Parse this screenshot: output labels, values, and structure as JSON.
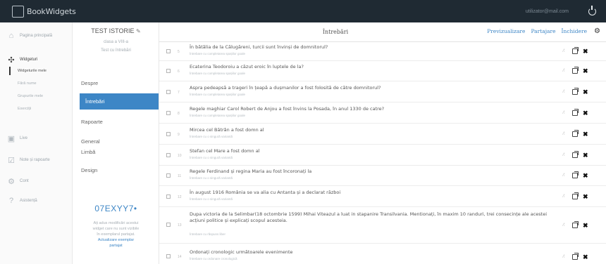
{
  "app": {
    "name": "BookWidgets",
    "user_email": "utilizator@mail.com"
  },
  "sidebar": {
    "home": "Pagina principală",
    "widgets": "Widgeturi",
    "sub_items": [
      "Widgeturile mele",
      "Fără nume",
      "Grupurile mele",
      "Exerciții"
    ],
    "live": "Live",
    "grading": "Note și rapoarte",
    "account": "Cont",
    "help": "Asistență"
  },
  "panel": {
    "title": "TEST ISTORIE",
    "class_label": "clasa a VIII-a",
    "subtitle": "Test cu întrebări",
    "menu": [
      "Despre",
      "Întrebări",
      "Rapoarte",
      "General",
      "Limbă",
      "Design"
    ],
    "active_index": 1,
    "code": "07EXYY7",
    "note_lines": [
      "Ați adus modificări acestui",
      "widget care nu sunt vizibile",
      "în exemplarul partajat."
    ],
    "note_link_lines": [
      "Actualizare exemplar",
      "partajat"
    ]
  },
  "header": {
    "title": "Întrebări",
    "preview": "Previzualizare",
    "share": "Partajare",
    "close": "Închidere"
  },
  "questions": [
    {
      "num": "5",
      "text": "În bătălia de la Călugăreni, turcii sunt învinși de domnitorul?",
      "sub": "Întrebare cu completarea spațiilor goale"
    },
    {
      "num": "6",
      "text": "Ecaterina Teodoroiu a căzut eroic în luptele de la?",
      "sub": "Întrebare cu completarea spațiilor goale"
    },
    {
      "num": "7",
      "text": "Aspra pedeapsă a trageri în țeapă a dușmanilor a fost folosită de către domnitorul?",
      "sub": "Întrebare cu completarea spațiilor goale"
    },
    {
      "num": "8",
      "text": "Regele maghiar Carol Robert de Anjou a fost învins la Posada, în anul 1330 de catre?",
      "sub": "Întrebare cu completarea spațiilor goale"
    },
    {
      "num": "9",
      "text": "Mircea cel Bătrân a fost domn al",
      "sub": "Întrebare cu o singură variantă"
    },
    {
      "num": "10",
      "text": "Stefan cel Mare a fost domn al",
      "sub": "Întrebare cu o singură variantă"
    },
    {
      "num": "11",
      "text": "Regele Ferdinand și regina Maria au fost încoronați la",
      "sub": "Întrebare cu o singură variantă"
    },
    {
      "num": "12",
      "text": "În august 1916 România se va alia cu Antanta și a declarat război",
      "sub": "Întrebare cu o singură variantă"
    },
    {
      "num": "13",
      "text": "Dupa victoria de la Selimbar(18 octombrie 1599) Mihai Viteazul a luat in stapanire Transilvania. Mentionați, în maxim 10 randuri, trei consecințe ale acestei acțiuni politice și explicați scopul acesteia.",
      "sub": "Întrebare cu răspuns liber"
    },
    {
      "num": "14",
      "text": "Ordonați cronologic următoarele evenimente",
      "sub": "Întrebare cu ordonare cronologică"
    }
  ],
  "colors": {
    "accent": "#3d86c6",
    "topbar": "#1f2a33"
  }
}
